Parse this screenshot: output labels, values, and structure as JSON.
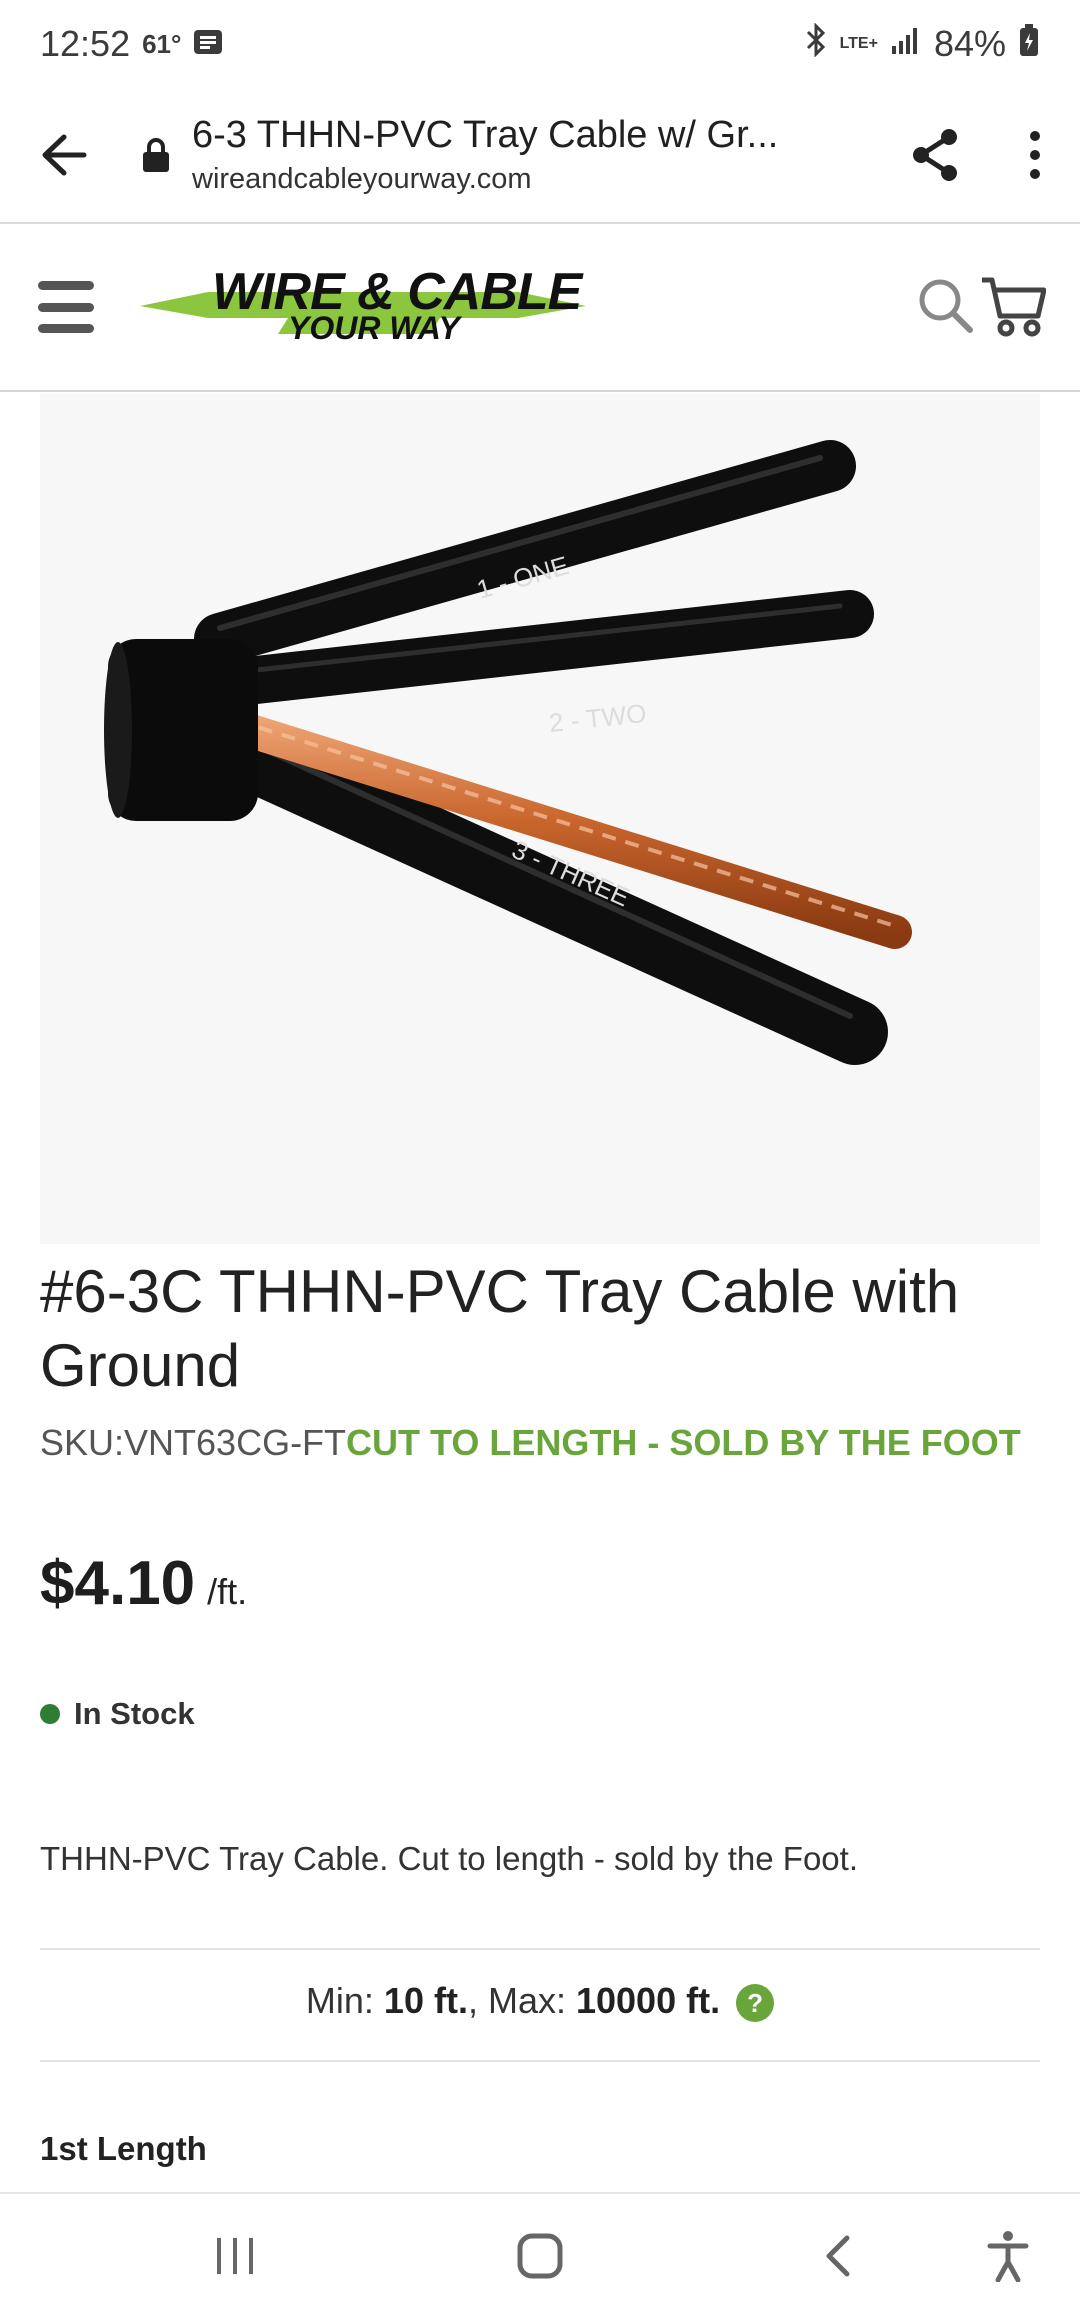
{
  "status_bar": {
    "time": "12:52",
    "temperature": "61°",
    "network": "LTE+",
    "battery": "84%"
  },
  "browser": {
    "tab_title": "6-3 THHN-PVC Tray Cable w/ Gr...",
    "url": "wireandcableyourway.com"
  },
  "site": {
    "logo_line1": "WIRE & CABLE",
    "logo_line2": "YOUR WAY",
    "logo_color": "#8cc63f"
  },
  "product": {
    "image_labels": [
      "1 - ONE",
      "2 - TWO",
      "3 - THREE"
    ],
    "title": "#6-3C THHN-PVC Tray Cable with Ground",
    "sku": "SKU:VNT63CG-FT",
    "sale_note": "CUT TO LENGTH - SOLD BY THE FOOT",
    "price": "$4.10",
    "unit": "/ft.",
    "stock": "In Stock",
    "description": "THHN-PVC Tray Cable. Cut to length - sold by the Foot.",
    "min_label": "Min: ",
    "min_value": "10 ft.",
    "max_label": ", Max: ",
    "max_value": "10000 ft.",
    "help": "?",
    "length_label": "1st Length"
  },
  "colors": {
    "accent_green": "#6aa53b",
    "stock_green": "#2e7d32"
  }
}
